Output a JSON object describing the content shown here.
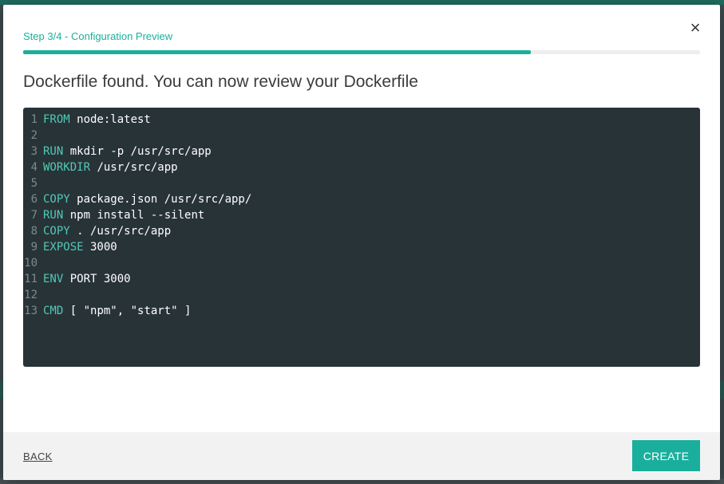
{
  "modal": {
    "step_label": "Step 3/4 - Configuration Preview",
    "progress_percent": 75,
    "heading": "Dockerfile found. You can now review your Dockerfile",
    "close_glyph": "×"
  },
  "code": {
    "lines": [
      {
        "num": "1",
        "kw": "FROM",
        "rest": " node:latest"
      },
      {
        "num": "2",
        "kw": "",
        "rest": ""
      },
      {
        "num": "3",
        "kw": "RUN",
        "rest": " mkdir -p /usr/src/app"
      },
      {
        "num": "4",
        "kw": "WORKDIR",
        "rest": " /usr/src/app"
      },
      {
        "num": "5",
        "kw": "",
        "rest": ""
      },
      {
        "num": "6",
        "kw": "COPY",
        "rest": " package.json /usr/src/app/"
      },
      {
        "num": "7",
        "kw": "RUN",
        "rest": " npm install --silent"
      },
      {
        "num": "8",
        "kw": "COPY",
        "rest": " . /usr/src/app"
      },
      {
        "num": "9",
        "kw": "EXPOSE",
        "rest": " 3000"
      },
      {
        "num": "10",
        "kw": "",
        "rest": ""
      },
      {
        "num": "11",
        "kw": "ENV",
        "rest": " PORT 3000"
      },
      {
        "num": "12",
        "kw": "",
        "rest": ""
      },
      {
        "num": "13",
        "kw": "CMD",
        "rest": " [ \"npm\", \"start\" ]"
      }
    ]
  },
  "footer": {
    "back_label": "BACK",
    "create_label": "CREATE"
  },
  "colors": {
    "accent": "#1aaf9c",
    "code_bg": "#283338",
    "keyword": "#4fcab6"
  }
}
